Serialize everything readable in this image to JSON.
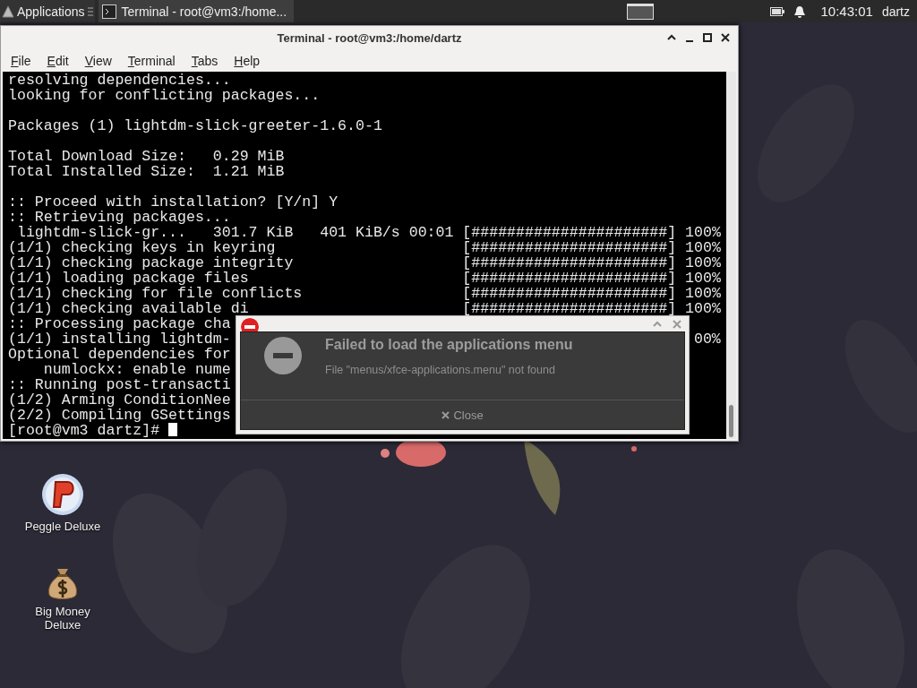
{
  "panel": {
    "app_menu": "Applications",
    "task": {
      "label": "Terminal - root@vm3:/home...",
      "selected": true
    },
    "clock": "10:43:01",
    "user": "dartz"
  },
  "terminal_window": {
    "title": "Terminal - root@vm3:/home/dartz",
    "menu": [
      "File",
      "Edit",
      "View",
      "Terminal",
      "Tabs",
      "Help"
    ],
    "lines": [
      {
        "kind": "text",
        "text": "resolving dependencies..."
      },
      {
        "kind": "text",
        "text": "looking for conflicting packages..."
      },
      {
        "kind": "blank"
      },
      {
        "kind": "text",
        "text": "Packages (1) lightdm-slick-greeter-1.6.0-1"
      },
      {
        "kind": "blank"
      },
      {
        "kind": "text",
        "text": "Total Download Size:   0.29 MiB"
      },
      {
        "kind": "text",
        "text": "Total Installed Size:  1.21 MiB"
      },
      {
        "kind": "blank"
      },
      {
        "kind": "text",
        "text": ":: Proceed with installation? [Y/n] Y"
      },
      {
        "kind": "text",
        "text": ":: Retrieving packages..."
      },
      {
        "kind": "progress",
        "text": " lightdm-slick-gr...   301.7 KiB   401 KiB/s 00:01",
        "bar": "[######################]",
        "percent": "100%"
      },
      {
        "kind": "progress",
        "text": "(1/1) checking keys in keyring",
        "bar": "[######################]",
        "percent": "100%"
      },
      {
        "kind": "progress",
        "text": "(1/1) checking package integrity",
        "bar": "[######################]",
        "percent": "100%"
      },
      {
        "kind": "progress",
        "text": "(1/1) loading package files",
        "bar": "[######################]",
        "percent": "100%"
      },
      {
        "kind": "progress",
        "text": "(1/1) checking for file conflicts",
        "bar": "[######################]",
        "percent": "100%"
      },
      {
        "kind": "progress",
        "text": "(1/1) checking available di",
        "bar": "[######################]",
        "percent": "100%"
      },
      {
        "kind": "text",
        "text": ":: Processing package cha"
      },
      {
        "kind": "progress",
        "text": "(1/1) installing lightdm-",
        "percent": "00%"
      },
      {
        "kind": "text",
        "text": "Optional dependencies for"
      },
      {
        "kind": "text",
        "text": "    numlockx: enable nume"
      },
      {
        "kind": "text",
        "text": ":: Running post-transacti"
      },
      {
        "kind": "text",
        "text": "(1/2) Arming ConditionNee"
      },
      {
        "kind": "text",
        "text": "(2/2) Compiling GSettings"
      }
    ],
    "prompt": "[root@vm3 dartz]#"
  },
  "notification": {
    "title": "Failed to load the applications menu",
    "message": "File \"menus/xfce-applications.menu\" not found",
    "button": "Close"
  },
  "desktop_icons": [
    {
      "label": "Peggle Deluxe",
      "kind": "ball"
    },
    {
      "label": "Big Money Deluxe",
      "kind": "bag"
    }
  ]
}
